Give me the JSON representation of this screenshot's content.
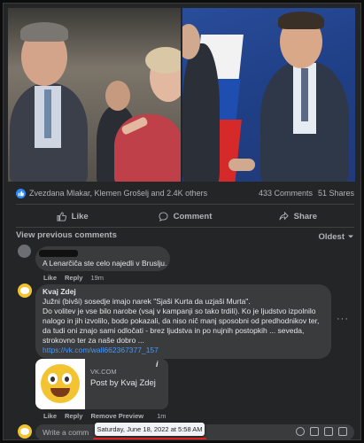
{
  "reactions": {
    "names": "Zvezdana Mlakar, Klemen Grošelj and 2.4K others",
    "comments": "433 Comments",
    "shares": "51 Shares"
  },
  "actions": {
    "like": "Like",
    "comment": "Comment",
    "share": "Share"
  },
  "comments_header": {
    "view_previous": "View previous comments",
    "sort": "Oldest"
  },
  "comment1": {
    "text": "A Lenarčiča ste celo najedli v Bruslju.",
    "like": "Like",
    "reply": "Reply",
    "time": "19m"
  },
  "comment2": {
    "author": "Kvaj Zdej",
    "lines": [
      "Južni (bivši) sosedje imajo narek \"Sjaši Kurta da uzjaši Murta\".",
      "Do volitev je vse bilo narobe (vsaj v kampanji so tako trdili). Ko je ljudstvo izpolnilo",
      "nalogo in jih izvolilo, bodo pokazali, da niso nič manj sposobni od predhodnikov ter,",
      "da tudi oni znajo sami odločati - brez ljudstva in po nujnih postopkih ... seveda,",
      "strokovno ter za naše dobro ..."
    ],
    "link": "https://vk.com/wall662367377_157",
    "card_domain": "VK.COM",
    "card_title": "Post by Kvaj Zdej",
    "like": "Like",
    "reply": "Reply",
    "remove_preview": "Remove Preview",
    "time": "1m"
  },
  "composer": {
    "placeholder": "Write a comm"
  },
  "tooltip": {
    "date": "Saturday, June 18, 2022 at 5:58 AM"
  },
  "colors": {
    "background": "#242526",
    "bubble": "#3a3b3c",
    "link": "#4599ff",
    "like_blue": "#2d88ff",
    "underline": "#e02020"
  }
}
